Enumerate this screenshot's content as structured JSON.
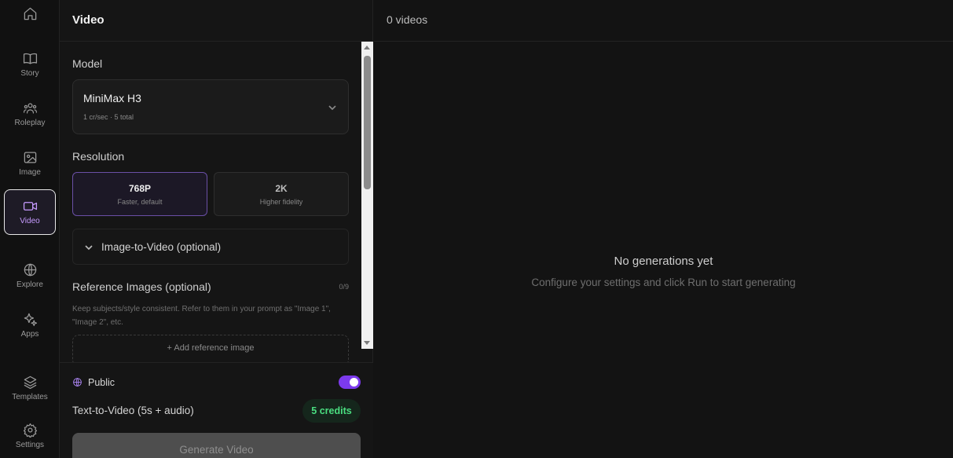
{
  "nav": {
    "home_icon": "home-icon",
    "items": [
      {
        "label": "Story",
        "icon": "book-icon"
      },
      {
        "label": "Roleplay",
        "icon": "users-icon"
      },
      {
        "label": "Image",
        "icon": "image-icon"
      },
      {
        "label": "Video",
        "icon": "video-icon",
        "active": true
      },
      {
        "label": "Explore",
        "icon": "globe-icon"
      },
      {
        "label": "Apps",
        "icon": "sparkles-icon"
      },
      {
        "label": "Templates",
        "icon": "layers-icon"
      },
      {
        "label": "Settings",
        "icon": "gear-icon"
      }
    ]
  },
  "panel": {
    "title": "Video",
    "model": {
      "label": "Model",
      "selected": "MiniMax H3",
      "detail": "1 cr/sec · 5 total"
    },
    "resolution": {
      "label": "Resolution",
      "options": [
        {
          "title": "768P",
          "subtitle": "Faster, default",
          "selected": true
        },
        {
          "title": "2K",
          "subtitle": "Higher fidelity",
          "selected": false
        }
      ]
    },
    "image_to_video": {
      "label": "Image-to-Video (optional)"
    },
    "reference": {
      "label": "Reference Images (optional)",
      "count": "0/9",
      "help": "Keep subjects/style consistent. Refer to them in your prompt as \"Image 1\", \"Image 2\", etc.",
      "add_label": "+ Add reference image"
    },
    "footer": {
      "public_label": "Public",
      "public_enabled": true,
      "mode_label": "Text-to-Video (5s + audio)",
      "credits": "5 credits",
      "generate_label": "Generate Video"
    }
  },
  "main": {
    "count": "0 videos",
    "empty_title": "No generations yet",
    "empty_subtitle": "Configure your settings and click Run to start generating"
  },
  "colors": {
    "accent": "#7c3aed",
    "active_nav": "#c79bff",
    "credits_green": "#4ade80"
  }
}
